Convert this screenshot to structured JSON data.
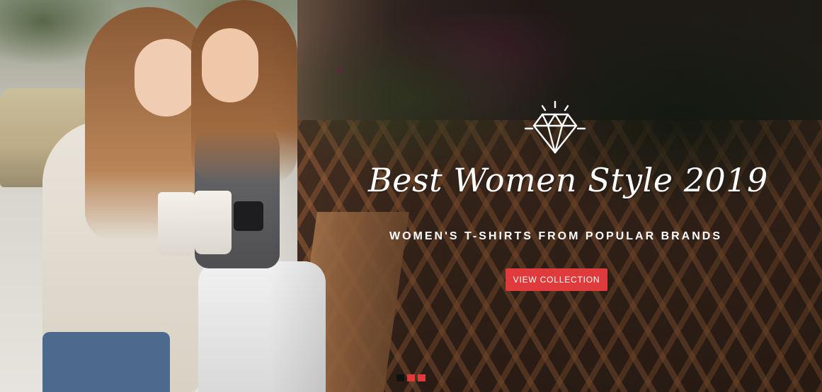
{
  "hero": {
    "icon": "diamond-icon",
    "headline": "Best Women Style 2019",
    "subheadline": "WOMEN'S T-SHIRTS FROM POPULAR BRANDS",
    "cta_label": "VIEW COLLECTION"
  },
  "slider": {
    "dots": [
      {
        "label": "",
        "active": true
      },
      {
        "label": "",
        "active": false
      },
      {
        "label": "",
        "active": false
      }
    ],
    "active_index": 0
  },
  "colors": {
    "accent": "#df3b3c",
    "text": "#ffffff",
    "active_dot": "#111111"
  }
}
